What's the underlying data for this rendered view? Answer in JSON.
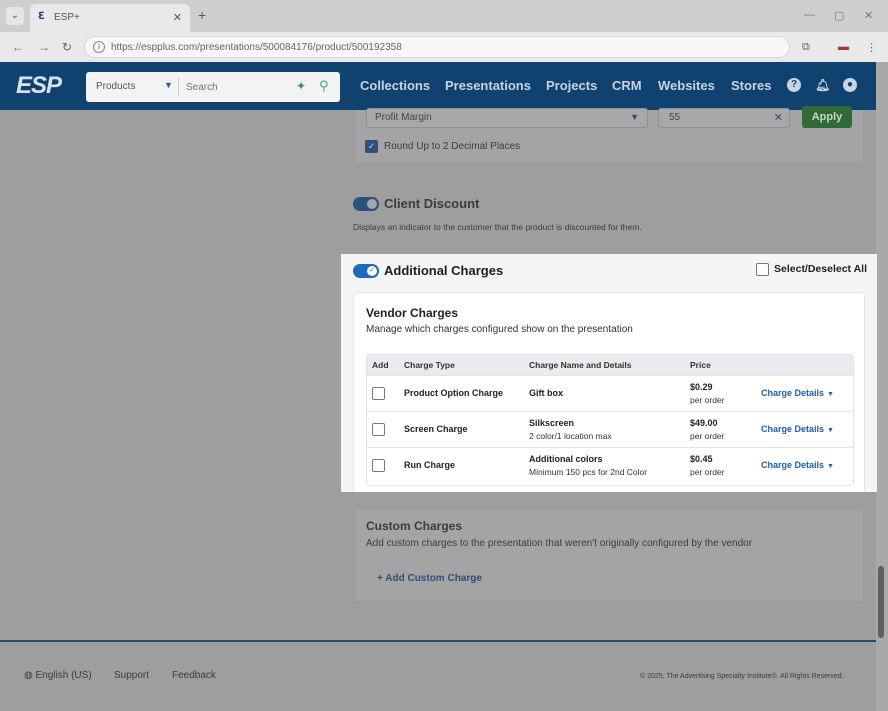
{
  "browser": {
    "tab_title": "ESP+",
    "tab_close": "✕",
    "new_tab": "+",
    "url": "https://espplus.com/presentations/500084176/product/500192358"
  },
  "header": {
    "logo": "ESP",
    "search_category": "Products",
    "search_placeholder": "Search",
    "nav": [
      "Collections",
      "Presentations",
      "Projects",
      "CRM",
      "Websites",
      "Stores"
    ]
  },
  "background": {
    "markup_select": "Profit Margin",
    "markup_value": "55",
    "apply_label": "Apply",
    "round_label": "Round Up to 2 Decimal Places",
    "client_discount_title": "Client Discount",
    "client_discount_desc": "Displays an indicator to the customer that the product is discounted for them.",
    "custom_title": "Custom Charges",
    "custom_desc": "Add custom charges to the presentation that weren't originally configured by the vendor",
    "add_custom": "Add Custom Charge",
    "footer_lang": "English (US)",
    "footer_support": "Support",
    "footer_feedback": "Feedback",
    "footer_copyright": "© 2025, The Advertising Specialty Institute®. All Rights Reserved."
  },
  "additional_charges": {
    "title": "Additional Charges",
    "select_all_label": "Select/Deselect All",
    "vendor_title": "Vendor Charges",
    "vendor_subtitle": "Manage which charges configured show on the presentation",
    "columns": [
      "Add",
      "Charge Type",
      "Charge Name and Details",
      "Price"
    ],
    "rows": [
      {
        "type": "Product Option Charge",
        "name": "Gift box",
        "detail": "",
        "price": "$0.29",
        "per": "per order",
        "details_label": "Charge Details"
      },
      {
        "type": "Screen Charge",
        "name": "Silkscreen",
        "detail": "2 color/1 location max",
        "price": "$49.00",
        "per": "per order",
        "details_label": "Charge Details"
      },
      {
        "type": "Run Charge",
        "name": "Additional colors",
        "detail": "Minimum 150 pcs for 2nd Color",
        "price": "$0.45",
        "per": "per order",
        "details_label": "Charge Details"
      }
    ]
  }
}
